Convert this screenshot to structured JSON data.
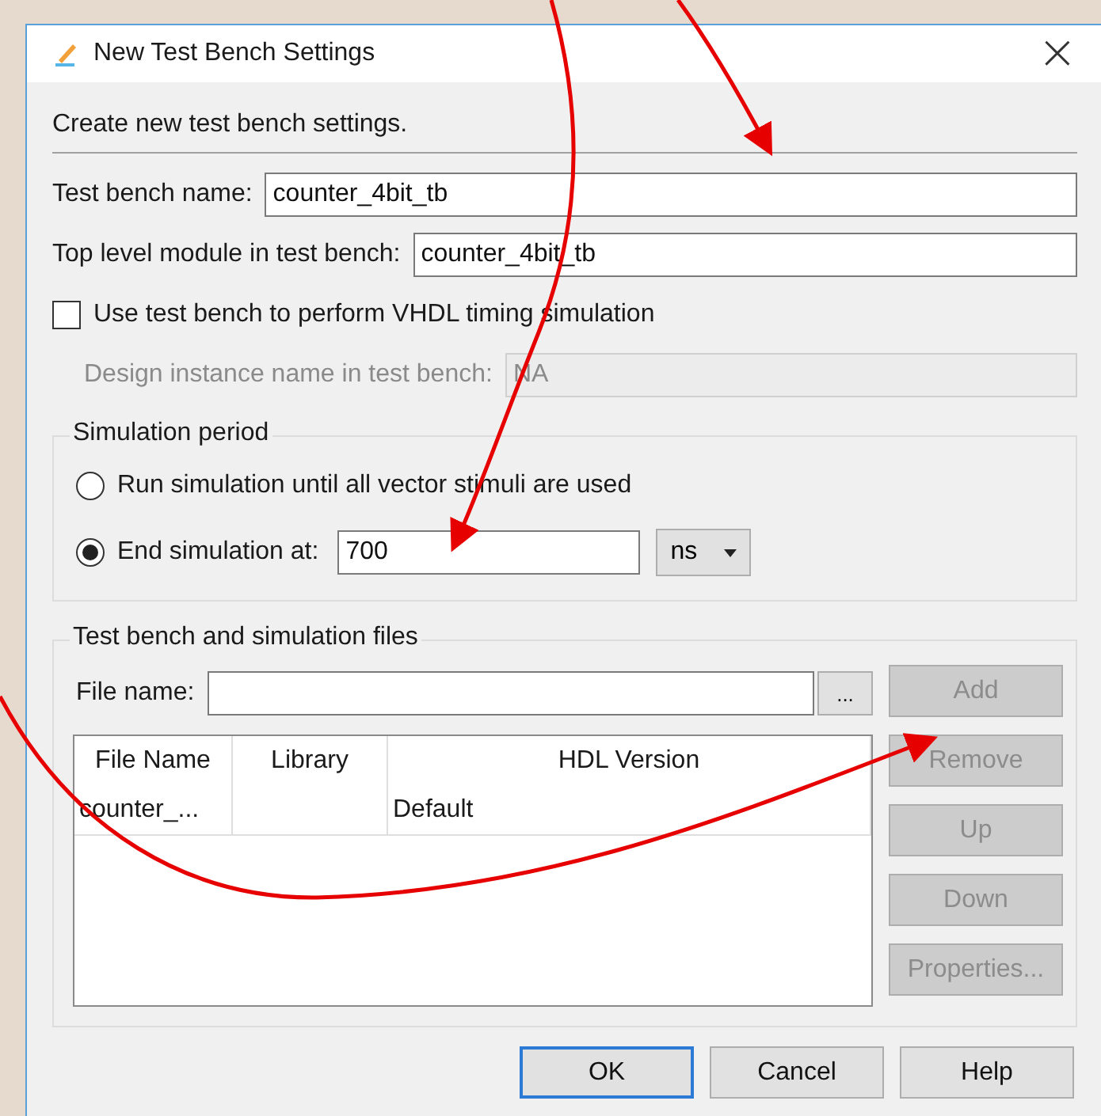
{
  "window": {
    "title": "New Test Bench Settings",
    "close": "×"
  },
  "intro": "Create new test bench settings.",
  "fields": [
    {
      "label": "Test bench name:",
      "value": "counter_4bit_tb",
      "disabled": false
    },
    {
      "label": "Top level module in test bench:",
      "value": "counter_4bit_tb",
      "disabled": false
    }
  ],
  "timing_checkbox": {
    "label": "Use test bench to perform VHDL timing simulation",
    "checked": false
  },
  "design_instance": {
    "label": "Design instance name in test bench:",
    "value": "NA",
    "disabled": true
  },
  "simulation_period": {
    "title": "Simulation period",
    "options": [
      {
        "label": "Run simulation until all vector stimuli are used",
        "selected": false
      },
      {
        "label": "End simulation at:",
        "selected": true
      }
    ],
    "end_value": "700",
    "unit": "ns"
  },
  "files": {
    "title": "Test bench and simulation files",
    "file_name_label": "File name:",
    "browse": "...",
    "columns": [
      "File Name",
      "Library",
      "HDL Version"
    ],
    "rows": [
      {
        "file_name": "counter_...",
        "hdl_version": "Default"
      }
    ],
    "buttons": [
      {
        "label": "Add",
        "disabled": true
      },
      {
        "label": "Remove",
        "disabled": true
      },
      {
        "label": "Up",
        "disabled": true
      },
      {
        "label": "Down",
        "disabled": true
      },
      {
        "label": "Properties...",
        "disabled": true
      }
    ]
  },
  "footer_buttons": [
    {
      "label": "OK",
      "default": true
    },
    {
      "label": "Cancel",
      "default": false
    },
    {
      "label": "Help",
      "default": false
    }
  ]
}
